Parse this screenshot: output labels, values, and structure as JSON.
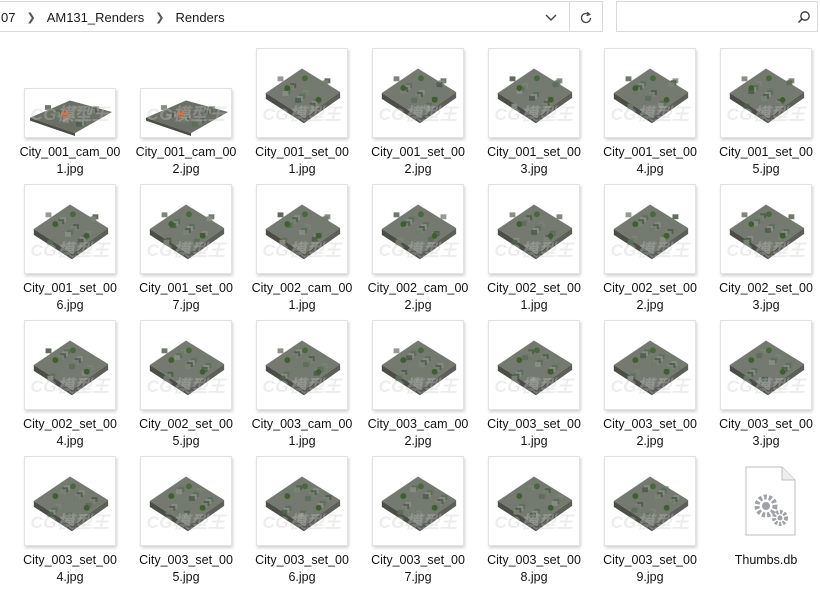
{
  "address": {
    "crumbs": [
      "07",
      "AM131_Renders",
      "Renders"
    ],
    "dropdown_icon": "chevron-down-icon",
    "refresh_icon": "refresh-icon"
  },
  "search": {
    "placeholder": "",
    "icon": "search-icon"
  },
  "watermark": "CG模型王",
  "files": [
    {
      "name": "City_001_cam_001.jpg",
      "kind": "flat"
    },
    {
      "name": "City_001_cam_002.jpg",
      "kind": "flat"
    },
    {
      "name": "City_001_set_001.jpg",
      "kind": "square"
    },
    {
      "name": "City_001_set_002.jpg",
      "kind": "square"
    },
    {
      "name": "City_001_set_003.jpg",
      "kind": "square"
    },
    {
      "name": "City_001_set_004.jpg",
      "kind": "square"
    },
    {
      "name": "City_001_set_005.jpg",
      "kind": "square"
    },
    {
      "name": "City_001_set_006.jpg",
      "kind": "square"
    },
    {
      "name": "City_001_set_007.jpg",
      "kind": "square"
    },
    {
      "name": "City_002_cam_001.jpg",
      "kind": "square"
    },
    {
      "name": "City_002_cam_002.jpg",
      "kind": "square"
    },
    {
      "name": "City_002_set_001.jpg",
      "kind": "square"
    },
    {
      "name": "City_002_set_002.jpg",
      "kind": "square"
    },
    {
      "name": "City_002_set_003.jpg",
      "kind": "square"
    },
    {
      "name": "City_002_set_004.jpg",
      "kind": "square"
    },
    {
      "name": "City_002_set_005.jpg",
      "kind": "square"
    },
    {
      "name": "City_003_cam_001.jpg",
      "kind": "square"
    },
    {
      "name": "City_003_cam_002.jpg",
      "kind": "square"
    },
    {
      "name": "City_003_set_001.jpg",
      "kind": "square"
    },
    {
      "name": "City_003_set_002.jpg",
      "kind": "square"
    },
    {
      "name": "City_003_set_003.jpg",
      "kind": "square"
    },
    {
      "name": "City_003_set_004.jpg",
      "kind": "square"
    },
    {
      "name": "City_003_set_005.jpg",
      "kind": "square"
    },
    {
      "name": "City_003_set_006.jpg",
      "kind": "square"
    },
    {
      "name": "City_003_set_007.jpg",
      "kind": "square"
    },
    {
      "name": "City_003_set_008.jpg",
      "kind": "square"
    },
    {
      "name": "City_003_set_009.jpg",
      "kind": "square"
    },
    {
      "name": "Thumbs.db",
      "kind": "file-icon"
    }
  ]
}
